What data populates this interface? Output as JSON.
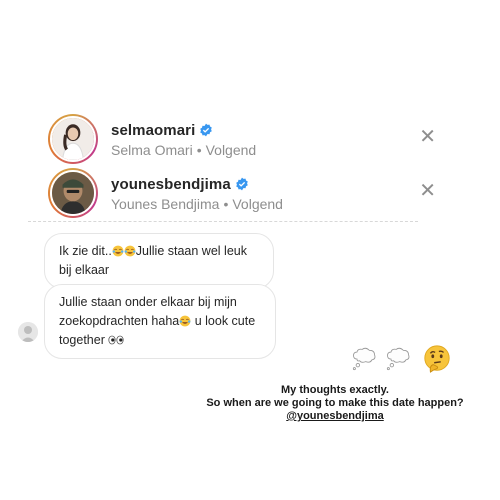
{
  "accounts": [
    {
      "username": "selmaomari",
      "display_name": "Selma Omari",
      "separator": "•",
      "follow_status": "Volgend",
      "verified": true,
      "close_icon": "close-icon"
    },
    {
      "username": "younesbendjima",
      "display_name": "Younes Bendjima",
      "separator": "•",
      "follow_status": "Volgend",
      "verified": true,
      "close_icon": "close-icon"
    }
  ],
  "messages": [
    {
      "part1": "Ik zie dit..",
      "part2": "Jullie staan wel leuk",
      "part3": "bij elkaar"
    },
    {
      "line1": "Jullie staan onder elkaar bij mijn",
      "line2a": "zoekopdrachten haha",
      "line2b": "u look cute",
      "line3": "together"
    }
  ],
  "reactions": [
    "thought-balloon-icon",
    "thought-balloon-icon",
    "thinking-face-icon"
  ],
  "caption": {
    "line1": "My thoughts exactly.",
    "line2": "So when are we going to make this date happen?",
    "mention": "@younesbendjima"
  },
  "colors": {
    "verified": "#3897f0",
    "secondary_text": "#8e8e8e",
    "story_ring_start": "#d6a245",
    "story_ring_end": "#c13b8c"
  }
}
